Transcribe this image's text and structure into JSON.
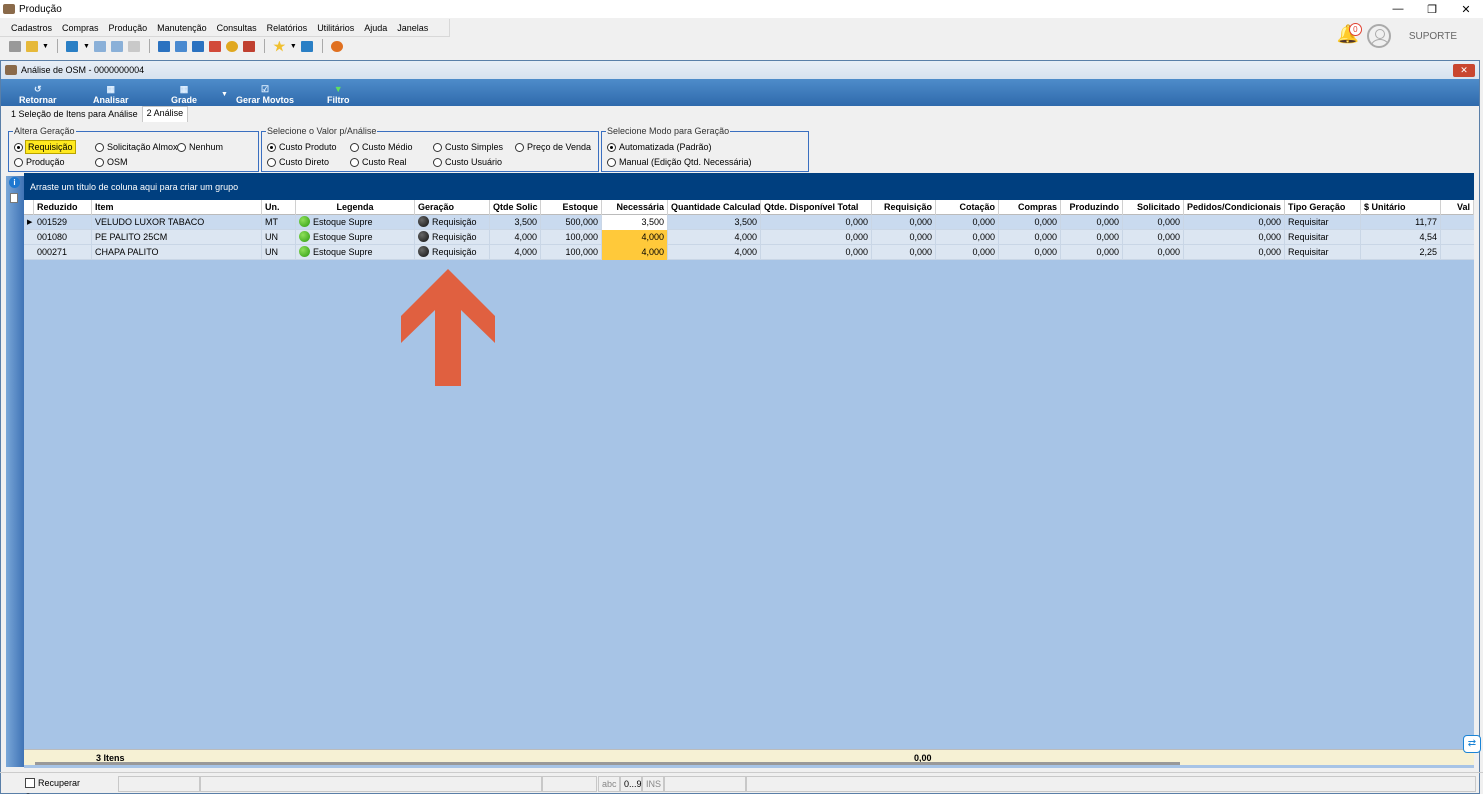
{
  "window": {
    "title": "Produção",
    "user": "SUPORTE",
    "notifications": "0"
  },
  "menu": [
    "Cadastros",
    "Compras",
    "Produção",
    "Manutenção",
    "Consultas",
    "Relatórios",
    "Utilitários",
    "Ajuda",
    "Janelas"
  ],
  "child": {
    "title": "Análise de OSM - 0000000004",
    "close": "✕"
  },
  "ribbon": {
    "retornar": "Retornar",
    "analisar": "Analisar",
    "grade": "Grade",
    "gerar": "Gerar Movtos",
    "filtro": "Filtro"
  },
  "tabs": {
    "tab1": "1 Seleção de Itens para Análise",
    "tab2": "2 Análise"
  },
  "groups": {
    "altera": {
      "legend": "Altera Geração",
      "opt1": "Requisição",
      "opt2": "Solicitação Almox",
      "opt3": "Nenhum",
      "opt4": "Produção",
      "opt5": "OSM"
    },
    "valor": {
      "legend": "Selecione o Valor p/Análise",
      "opt1": "Custo Produto",
      "opt2": "Custo Médio",
      "opt3": "Custo Simples",
      "opt4": "Preço de Venda",
      "opt5": "Custo Direto",
      "opt6": "Custo Real",
      "opt7": "Custo Usuário"
    },
    "modo": {
      "legend": "Selecione Modo para Geração",
      "opt1": "Automatizada (Padrão)",
      "opt2": "Manual (Edição Qtd. Necessária)"
    }
  },
  "grid": {
    "grouping_hint": "Arraste um título de coluna aqui para criar um grupo",
    "headers": {
      "reduzido": "Reduzido",
      "item": "Item",
      "un": "Un.",
      "legenda": "Legenda",
      "geracao": "Geração",
      "qtde_solic": "Qtde Solic",
      "estoque": "Estoque",
      "necessaria": "Necessária",
      "qtd_calc": "Quantidade Calculad",
      "qtd_disp": "Qtde. Disponível Total",
      "requisicao": "Requisição",
      "cotacao": "Cotação",
      "compras": "Compras",
      "produzindo": "Produzindo",
      "solicitado": "Solicitado",
      "pedidos": "Pedidos/Condicionais",
      "tipo": "Tipo Geração",
      "unitario": "$ Unitário",
      "valor": "Val"
    },
    "rows": [
      {
        "reduzido": "001529",
        "item": "VELUDO LUXOR TABACO",
        "un": "MT",
        "legenda": "Estoque Supre",
        "geracao": "Requisição",
        "qtde_solic": "3,500",
        "estoque": "500,000",
        "necessaria": "3,500",
        "qtd_calc": "3,500",
        "qtd_disp": "0,000",
        "requisicao": "0,000",
        "cotacao": "0,000",
        "compras": "0,000",
        "produzindo": "0,000",
        "solicitado": "0,000",
        "pedidos": "0,000",
        "tipo": "Requisitar",
        "unitario": "11,77"
      },
      {
        "reduzido": "001080",
        "item": "PE PALITO 25CM",
        "un": "UN",
        "legenda": "Estoque Supre",
        "geracao": "Requisição",
        "qtde_solic": "4,000",
        "estoque": "100,000",
        "necessaria": "4,000",
        "qtd_calc": "4,000",
        "qtd_disp": "0,000",
        "requisicao": "0,000",
        "cotacao": "0,000",
        "compras": "0,000",
        "produzindo": "0,000",
        "solicitado": "0,000",
        "pedidos": "0,000",
        "tipo": "Requisitar",
        "unitario": "4,54"
      },
      {
        "reduzido": "000271",
        "item": "CHAPA PALITO",
        "un": "UN",
        "legenda": "Estoque Supre",
        "geracao": "Requisição",
        "qtde_solic": "4,000",
        "estoque": "100,000",
        "necessaria": "4,000",
        "qtd_calc": "4,000",
        "qtd_disp": "0,000",
        "requisicao": "0,000",
        "cotacao": "0,000",
        "compras": "0,000",
        "produzindo": "0,000",
        "solicitado": "0,000",
        "pedidos": "0,000",
        "tipo": "Requisitar",
        "unitario": "2,25"
      }
    ],
    "footer_count": "3 Itens",
    "footer_total": "0,00"
  },
  "status": {
    "recuperar": "Recuperar Sempre",
    "abc": "abc",
    "num": "0...9",
    "ins": "INS"
  },
  "colors": {
    "accent": "#2f6aac",
    "grid_bg": "#a7c4e6",
    "group_bar": "#003f7f",
    "highlight": "#ffc93a",
    "arrow": "#e06040"
  }
}
